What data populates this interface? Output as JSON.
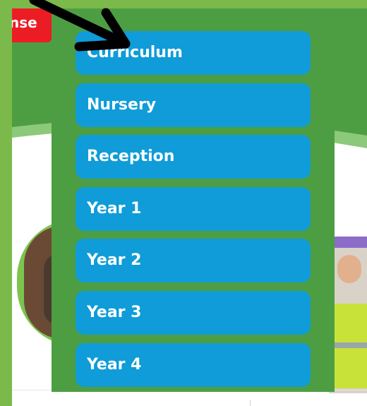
{
  "header": {
    "red_button_label": "nse"
  },
  "menu": {
    "items": [
      {
        "label": "Curriculum"
      },
      {
        "label": "Nursery"
      },
      {
        "label": "Reception"
      },
      {
        "label": "Year 1"
      },
      {
        "label": "Year 2"
      },
      {
        "label": "Year 3"
      },
      {
        "label": "Year 4"
      }
    ]
  },
  "colors": {
    "green_band": "#4d9e42",
    "menu_item": "#0f9cd8",
    "red_button": "#ec1c24",
    "border": "#7bb94b"
  },
  "icons": {
    "pointer": "arrow-icon"
  }
}
